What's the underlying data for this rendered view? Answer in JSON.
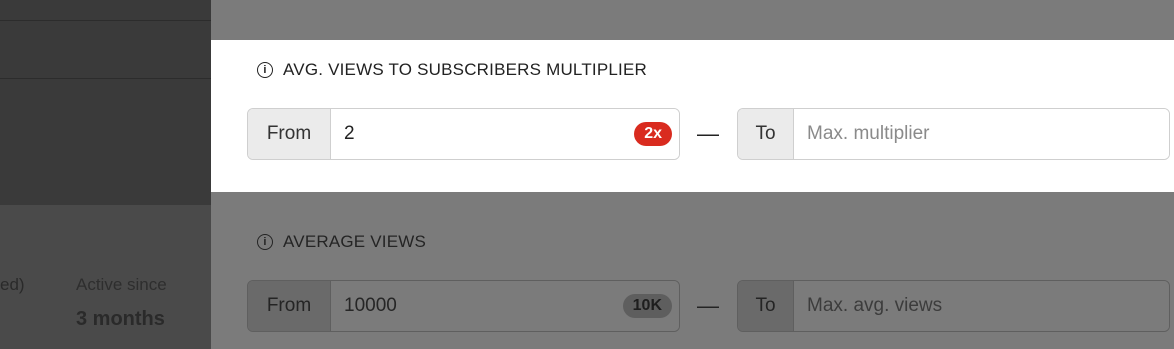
{
  "background": {
    "stat_fragment": "ed)",
    "stat_label": "Active since",
    "stat_value": "3 months"
  },
  "filters": [
    {
      "title": "AVG. VIEWS TO SUBSCRIBERS MULTIPLIER",
      "info_icon": "i",
      "from_label": "From",
      "from_value": "2",
      "from_badge": "2x",
      "separator": "—",
      "to_label": "To",
      "to_placeholder": "Max. multiplier"
    },
    {
      "title": "AVERAGE VIEWS",
      "info_icon": "i",
      "from_label": "From",
      "from_value": "10000",
      "from_badge": "10K",
      "separator": "—",
      "to_label": "To",
      "to_placeholder": "Max. avg. views"
    }
  ],
  "colors": {
    "overlay": "#7b7b7b",
    "highlight_panel": "#ffffff",
    "badge_red": "#d92b1f",
    "badge_grey": "#d6d6d6"
  }
}
